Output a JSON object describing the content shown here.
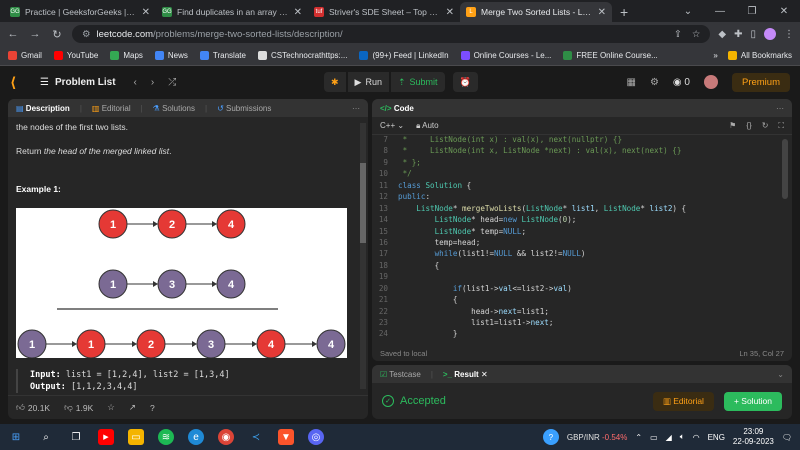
{
  "browser": {
    "tabs": [
      {
        "title": "Practice | GeeksforGeeks | A com",
        "fav_text": "GG",
        "fav_color": "#2f8d46",
        "active": false
      },
      {
        "title": "Find duplicates in an array | Prac",
        "fav_text": "GG",
        "fav_color": "#2f8d46",
        "active": false
      },
      {
        "title": "Striver's SDE Sheet – Top Coding",
        "fav_text": "tuf",
        "fav_color": "#d32f2f",
        "active": false
      },
      {
        "title": "Merge Two Sorted Lists - LeetCod",
        "fav_text": "L",
        "fav_color": "#ffa116",
        "active": true
      }
    ],
    "url_host": "leetcode.com",
    "url_path": "/problems/merge-two-sorted-lists/description/",
    "bookmarks": [
      {
        "label": "Gmail",
        "color": "#ea4335"
      },
      {
        "label": "YouTube",
        "color": "#ff0000"
      },
      {
        "label": "Maps",
        "color": "#34a853"
      },
      {
        "label": "News",
        "color": "#4285f4"
      },
      {
        "label": "Translate",
        "color": "#4285f4"
      },
      {
        "label": "CSTechnocrathttps:...",
        "color": "#dddddd"
      },
      {
        "label": "(99+) Feed | LinkedIn",
        "color": "#0a66c2"
      },
      {
        "label": "Online Courses - Le...",
        "color": "#7c4dff"
      },
      {
        "label": "FREE Online Course...",
        "color": "#2f8d46"
      }
    ],
    "all_bookmarks": "All Bookmarks"
  },
  "lc": {
    "problem_list": "Problem List",
    "run": "Run",
    "submit": "Submit",
    "streak": "0",
    "premium": "Premium"
  },
  "desc": {
    "tabs": [
      "Description",
      "Editorial",
      "Solutions",
      "Submissions"
    ],
    "line1": "the nodes of the first two lists.",
    "return_pre": "Return ",
    "return_em": "the head of the merged linked list",
    "return_post": ".",
    "example_title": "Example 1:",
    "list1": [
      "1",
      "2",
      "4"
    ],
    "list2": [
      "1",
      "3",
      "4"
    ],
    "merged": [
      "1",
      "1",
      "2",
      "3",
      "4",
      "4"
    ],
    "merged_colors": [
      "purple",
      "red",
      "red",
      "purple",
      "red",
      "purple"
    ],
    "input_label": "Input:",
    "input_value": " list1 = [1,2,4], list2 = [1,3,4]",
    "output_label": "Output:",
    "output_value": " [1,1,2,3,4,4]",
    "likes": "20.1K",
    "dislikes": "1.9K"
  },
  "code": {
    "title": "Code",
    "language": "C++",
    "mode": "Auto",
    "saved": "Saved to local",
    "position": "Ln 35, Col 27",
    "line_numbers": [
      "7",
      "8",
      "9",
      "10",
      "11",
      "12",
      "13",
      "14",
      "15",
      "16",
      "17",
      "18",
      "19",
      "20",
      "21",
      "22",
      "23",
      "24"
    ]
  },
  "result": {
    "tabs": [
      "Testcase",
      "Result"
    ],
    "status": "Accepted",
    "editorial": "Editorial",
    "solution": "Solution"
  },
  "taskbar": {
    "fx": "GBP/INR",
    "fx_change": "-0.54%",
    "lang": "ENG",
    "time": "23:09",
    "date": "22-09-2023"
  }
}
